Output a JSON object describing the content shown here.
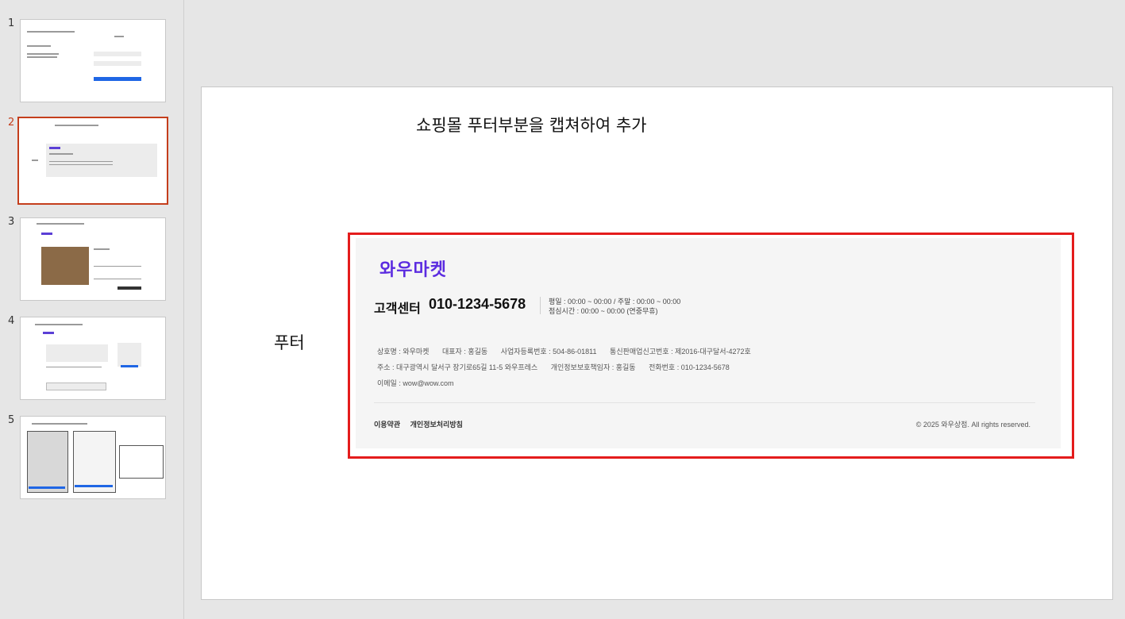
{
  "sidebar": {
    "slides": [
      {
        "number": "1"
      },
      {
        "number": "2"
      },
      {
        "number": "3"
      },
      {
        "number": "4"
      },
      {
        "number": "5"
      }
    ]
  },
  "slide": {
    "title": "쇼핑몰 푸터부분을 캡쳐하여 추가",
    "side_label": "푸터"
  },
  "footer": {
    "brand": "와우마켓",
    "cs_title": "고객센터",
    "cs_phone": "010-1234-5678",
    "hours_line1": "평일 : 00:00 ~ 00:00 / 주말 : 00:00 ~ 00:00",
    "hours_line2": "점심시간 : 00:00 ~ 00:00 (연중무휴)",
    "company_name": "상호명 : 와우마켓",
    "ceo": "대표자 : 홍길동",
    "biz_no": "사업자등록번호 : 504-86-01811",
    "ecommerce_no": "통신판매업신고번호 : 제2016-대구달서-4272호",
    "address": "주소 : 대구광역시 달서구 장기로65길 11-5 와우프레스",
    "privacy_officer": "개인정보보호책임자 : 홍길동",
    "phone": "전화번호 : 010-1234-5678",
    "email": "이메일 : wow@wow.com",
    "terms_link": "이용약관",
    "privacy_link": "개인정보처리방침",
    "copyright": "© 2025 와우상점. All rights reserved."
  },
  "colors": {
    "highlight_border": "#e41c1c",
    "brand": "#5b2be0",
    "active_thumb": "#c43e1c"
  }
}
